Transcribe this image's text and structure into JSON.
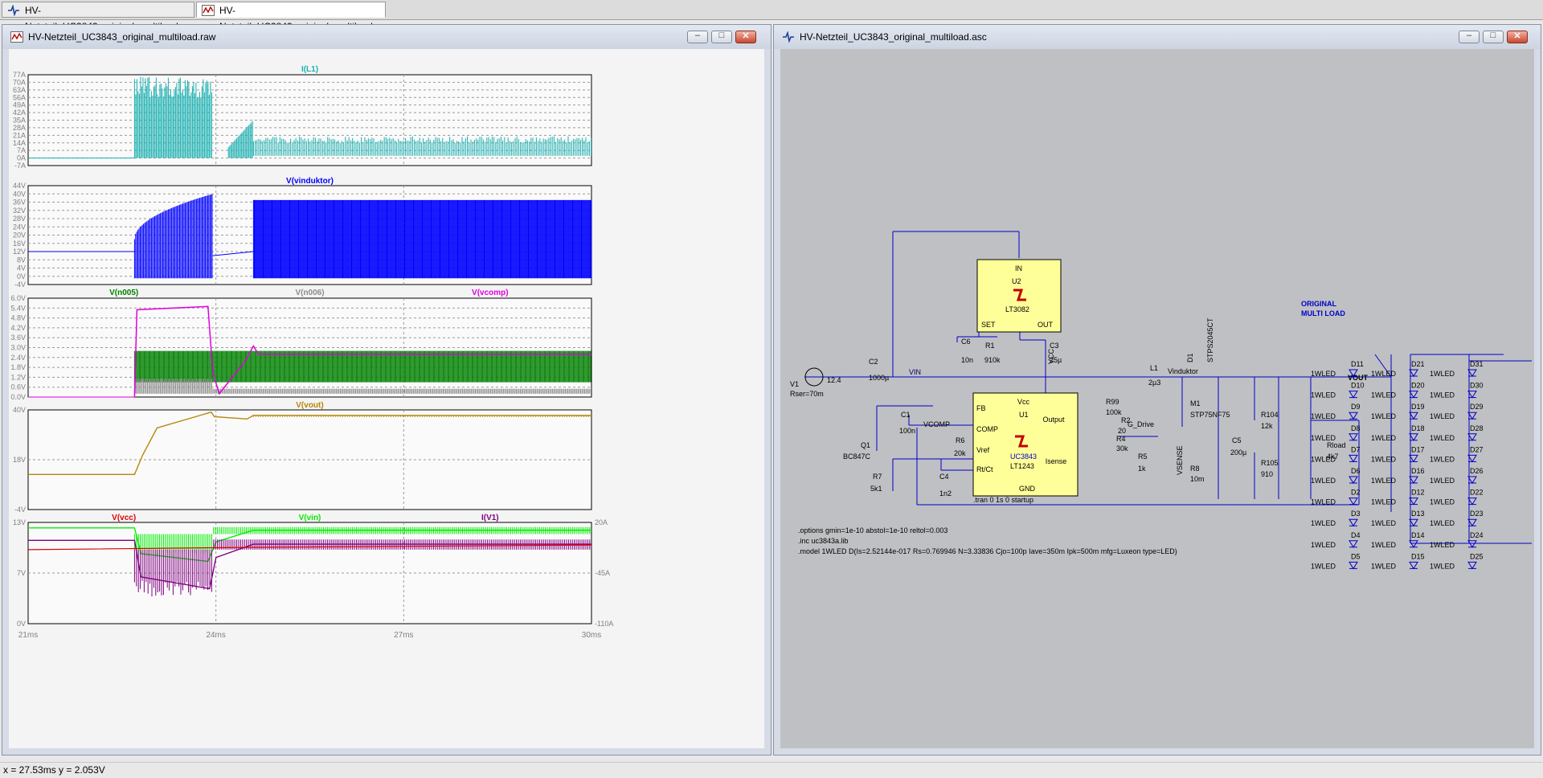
{
  "tabs": [
    {
      "label": "HV-Netzteil_UC3843_original_multiload.asc"
    },
    {
      "label": "HV-Netzteil_UC3843_original_multiload.raw"
    }
  ],
  "waveform_window": {
    "title": "HV-Netzteil_UC3843_original_multiload.raw",
    "buttons": {
      "minimize": "–",
      "maximize": "□",
      "close": "✕"
    }
  },
  "schematic_window": {
    "title": "HV-Netzteil_UC3843_original_multiload.asc",
    "buttons": {
      "minimize": "–",
      "maximize": "□",
      "close": "✕"
    }
  },
  "status": {
    "readout": "x = 27.53ms    y = 2.053V"
  },
  "colors": {
    "cyan": "#1bb0b0",
    "blue": "#0000ff",
    "green": "#008000",
    "gray": "#8c8c8c",
    "magenta": "#e000e0",
    "olive": "#b8860b",
    "red": "#dd0000",
    "lime": "#00ee00",
    "purple": "#800080",
    "wire": "#0000c8"
  },
  "chart_data": [
    {
      "type": "line",
      "title": "",
      "series": [
        {
          "name": "I(L1)",
          "color": "#1bb0b0"
        }
      ],
      "ylim": [
        -7,
        77
      ],
      "yticks": [
        "77A",
        "70A",
        "63A",
        "56A",
        "49A",
        "42A",
        "35A",
        "28A",
        "21A",
        "14A",
        "7A",
        "0A",
        "-7A"
      ],
      "xlim": [
        21,
        30
      ],
      "xunit": "ms"
    },
    {
      "type": "line",
      "series": [
        {
          "name": "V(vinduktor)",
          "color": "#0000ff"
        }
      ],
      "ylim": [
        -4,
        44
      ],
      "yticks": [
        "44V",
        "40V",
        "36V",
        "32V",
        "28V",
        "24V",
        "20V",
        "16V",
        "12V",
        "8V",
        "4V",
        "0V",
        "-4V"
      ],
      "xlim": [
        21,
        30
      ]
    },
    {
      "type": "line",
      "series": [
        {
          "name": "V(n005)",
          "color": "#008000"
        },
        {
          "name": "V(n006)",
          "color": "#8c8c8c"
        },
        {
          "name": "V(vcomp)",
          "color": "#e000e0"
        }
      ],
      "ylim": [
        0,
        6.0
      ],
      "yticks": [
        "6.0V",
        "5.4V",
        "4.8V",
        "4.2V",
        "3.6V",
        "3.0V",
        "2.4V",
        "1.8V",
        "1.2V",
        "0.6V",
        "0.0V"
      ],
      "xlim": [
        21,
        30
      ]
    },
    {
      "type": "line",
      "series": [
        {
          "name": "V(vout)",
          "color": "#b8860b"
        }
      ],
      "ylim": [
        -4,
        40
      ],
      "yticks": [
        "40V",
        "18V",
        "-4V"
      ],
      "xlim": [
        21,
        30
      ]
    },
    {
      "type": "line",
      "series": [
        {
          "name": "V(vcc)",
          "color": "#dd0000"
        },
        {
          "name": "V(vin)",
          "color": "#00ee00"
        },
        {
          "name": "I(V1)",
          "color": "#800080"
        }
      ],
      "ylim": [
        0,
        13
      ],
      "yticks": [
        "13V",
        "7V",
        "0V"
      ],
      "y2ticks": [
        "20A",
        "-45A",
        "-110A"
      ],
      "xlim": [
        21,
        30
      ],
      "xticks": [
        "21ms",
        "24ms",
        "27ms",
        "30ms"
      ]
    }
  ],
  "schematic": {
    "components": {
      "u2": {
        "pin_in": "IN",
        "ref": "U2",
        "part": "LT3082",
        "pin_set": "SET",
        "pin_out": "OUT"
      },
      "c6": {
        "ref": "C6",
        "val": "10n"
      },
      "r1": {
        "ref": "R1",
        "val": "910k"
      },
      "c3": {
        "ref": "C3",
        "val": "25µ"
      },
      "c2": {
        "ref": "C2",
        "val": "1000µ"
      },
      "v1": {
        "ref": "V1",
        "val": "12.4",
        "rser": "Rser=70m"
      },
      "l1": {
        "ref": "L1",
        "val": "2µ3"
      },
      "d1": {
        "ref": "D1",
        "part": "STPS2045CT"
      },
      "m1": {
        "ref": "M1",
        "part": "STP75NF75"
      },
      "r99": {
        "ref": "R99",
        "val": "100k"
      },
      "r2": {
        "ref": "R2",
        "val": "20"
      },
      "r4": {
        "ref": "R4",
        "val": "30k"
      },
      "r5": {
        "ref": "R5",
        "val": "1k"
      },
      "r8": {
        "ref": "R8",
        "val": "10m"
      },
      "c5": {
        "ref": "C5",
        "val": "200µ"
      },
      "r104": {
        "ref": "R104",
        "val": "12k"
      },
      "r105": {
        "ref": "R105",
        "val": "910"
      },
      "rload": {
        "ref": "Rload",
        "val": "4k7"
      },
      "c1": {
        "ref": "C1",
        "val": "100n"
      },
      "r6": {
        "ref": "R6",
        "val": "20k"
      },
      "c4": {
        "ref": "C4",
        "val": "1n2"
      },
      "q1": {
        "ref": "Q1",
        "part": "BC847C"
      },
      "r7": {
        "ref": "R7",
        "val": "5k1"
      },
      "u1": {
        "vcc": "Vcc",
        "fb": "FB",
        "ref": "U1",
        "comp": "COMP",
        "vref": "Vref",
        "rtct": "Rt/Ct",
        "output": "Output",
        "isense": "Isense",
        "gnd": "GND",
        "part1": "UC3843",
        "part2": "LT1243"
      }
    },
    "nets": {
      "vin": "VIN",
      "vcc": "VCC",
      "vinduktor": "Vinduktor",
      "vout": "VOUT",
      "g_drive": "G_Drive",
      "vsense": "VSENSE",
      "vcomp": "VCOMP"
    },
    "note": [
      "ORIGINAL",
      "MULTI LOAD"
    ],
    "tran": ".tran 0 1s 0 startup",
    "directives": [
      ".options gmin=1e-10 abstol=1e-10 reltol=0.003",
      ".inc uc3843a.lib",
      ".model 1WLED D(Is=2.52144e-017 Rs=0.769946 N=3.33836 Cjo=100p Iave=350m Ipk=500m mfg=Luxeon type=LED)"
    ],
    "led_label": "1WLED",
    "led_columns": [
      [
        "D11",
        "D10",
        "D9",
        "D8",
        "D7",
        "D6",
        "D2",
        "D3",
        "D4",
        "D5"
      ],
      [
        "D21",
        "D20",
        "D19",
        "D18",
        "D17",
        "D16",
        "D12",
        "D13",
        "D14",
        "D15"
      ],
      [
        "D31",
        "D30",
        "D29",
        "D28",
        "D27",
        "D26",
        "D22",
        "D23",
        "D24",
        "D25"
      ]
    ]
  }
}
